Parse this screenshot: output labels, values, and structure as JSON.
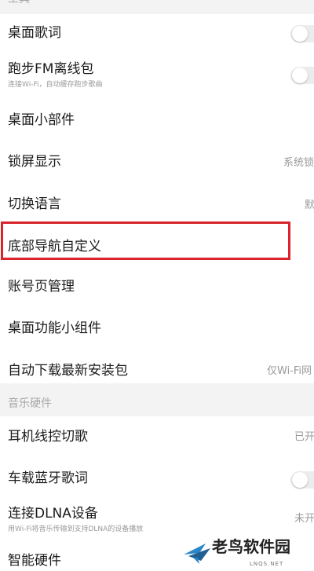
{
  "section_tools": {
    "label": "工具",
    "items": [
      {
        "title": "桌面歌词",
        "toggle": false
      },
      {
        "title": "跑步FM离线包",
        "subtitle": "连接Wi-Fi，自动缓存跑步歌曲",
        "toggle": false
      },
      {
        "title": "桌面小部件"
      },
      {
        "title": "锁屏显示",
        "value": "系统锁"
      },
      {
        "title": "切换语言",
        "value": "默"
      },
      {
        "title": "底部导航自定义",
        "highlighted": true
      },
      {
        "title": "账号页管理"
      },
      {
        "title": "桌面功能小组件"
      },
      {
        "title": "自动下载最新安装包",
        "value": "仅Wi-Fi网"
      }
    ]
  },
  "section_hardware": {
    "label": "音乐硬件",
    "items": [
      {
        "title": "耳机线控切歌",
        "value": "已开"
      },
      {
        "title": "车载蓝牙歌词",
        "toggle": false
      },
      {
        "title": "连接DLNA设备",
        "subtitle": "用Wi-Fi将音乐传输到支持DLNA的设备播放",
        "value": "未开"
      },
      {
        "title": "智能硬件"
      }
    ]
  },
  "watermark": {
    "name": "老鸟软件园",
    "url": "LNQS.NET"
  },
  "colors": {
    "highlight_border": "#d9242b",
    "background": "#f3f3f3",
    "card": "#ffffff"
  }
}
